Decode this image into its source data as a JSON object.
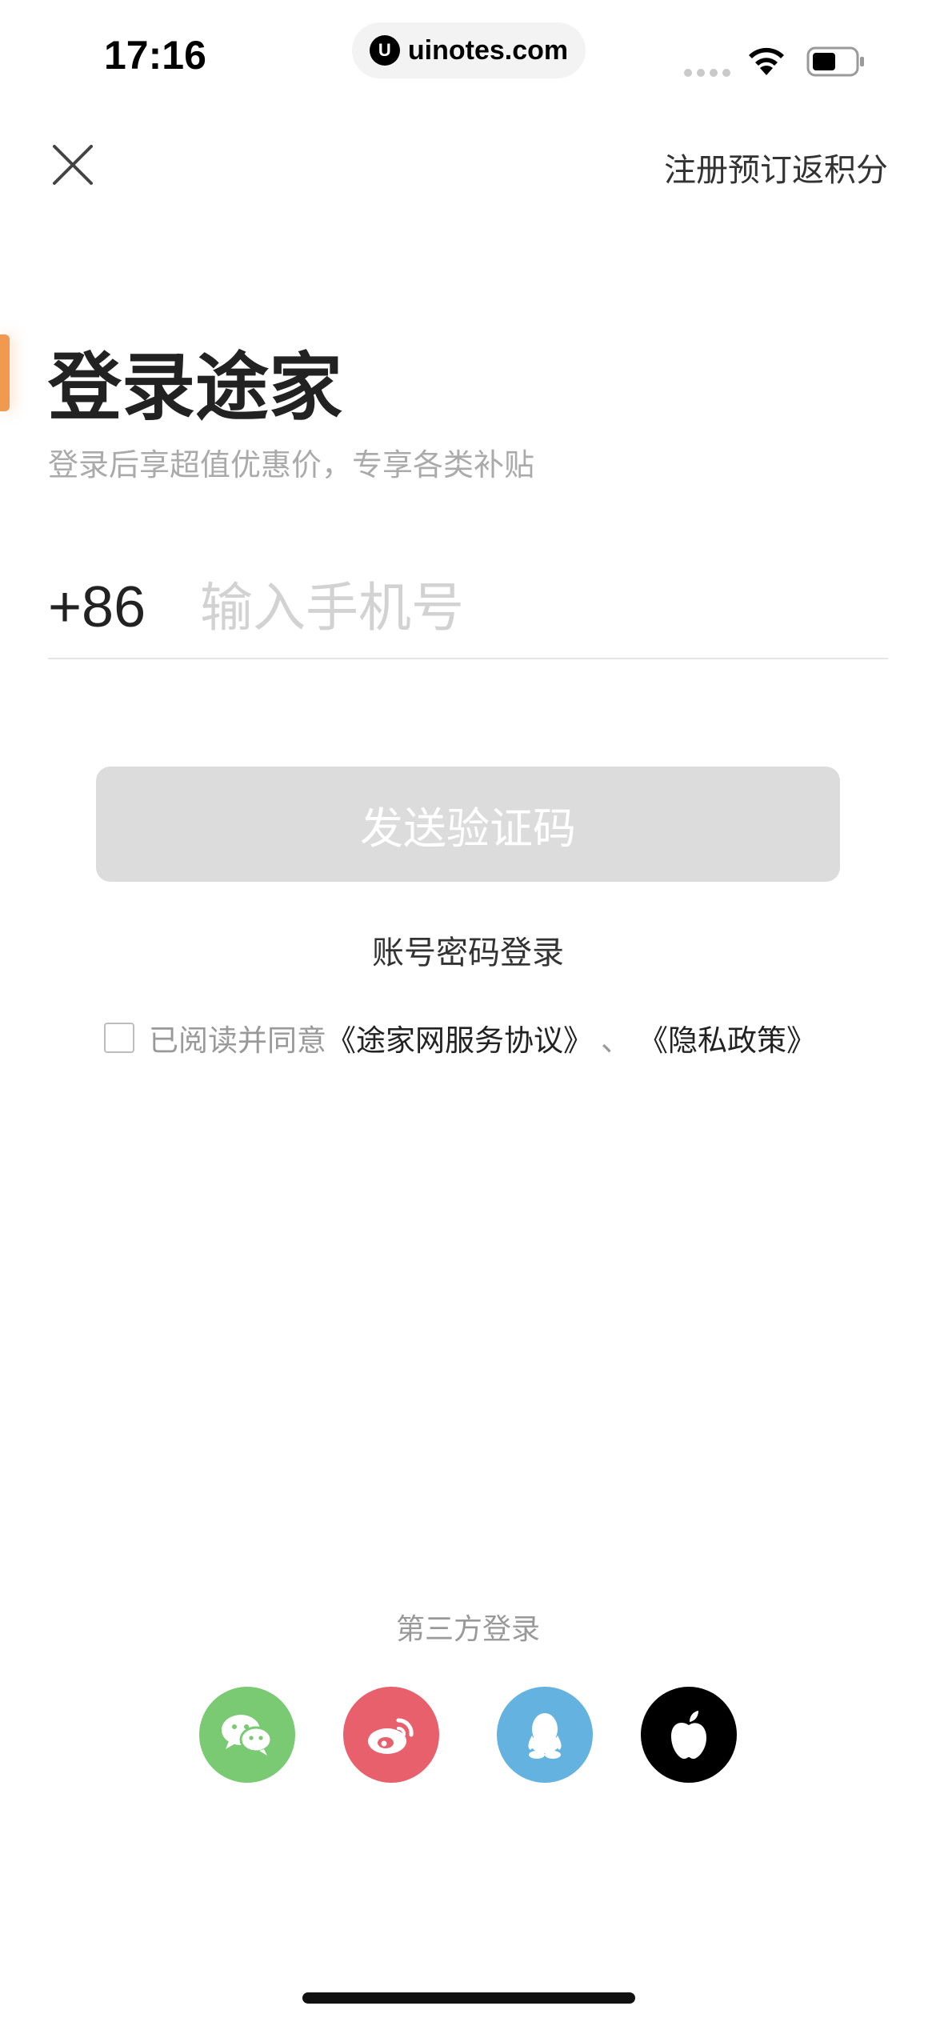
{
  "status_bar": {
    "time": "17:16",
    "url": "uinotes.com",
    "url_logo": "U"
  },
  "header": {
    "register_link": "注册预订返积分"
  },
  "main": {
    "title": "登录途家",
    "subtitle": "登录后享超值优惠价，专享各类补贴",
    "country_code": "+86",
    "phone_placeholder": "输入手机号",
    "send_button": "发送验证码",
    "password_login": "账号密码登录"
  },
  "agreement": {
    "prefix": "已阅读并同意",
    "terms": "《途家网服务协议》",
    "separator": "、",
    "privacy": "《隐私政策》",
    "checked": false
  },
  "third_party": {
    "label": "第三方登录",
    "providers": [
      "wechat-icon",
      "weibo-icon",
      "qq-icon",
      "apple-icon"
    ]
  },
  "colors": {
    "accent": "#f0994f",
    "button_disabled": "#dcdcdc",
    "wechat": "#79ca72",
    "weibo": "#e8606c",
    "qq": "#64b2df",
    "apple": "#000000"
  }
}
